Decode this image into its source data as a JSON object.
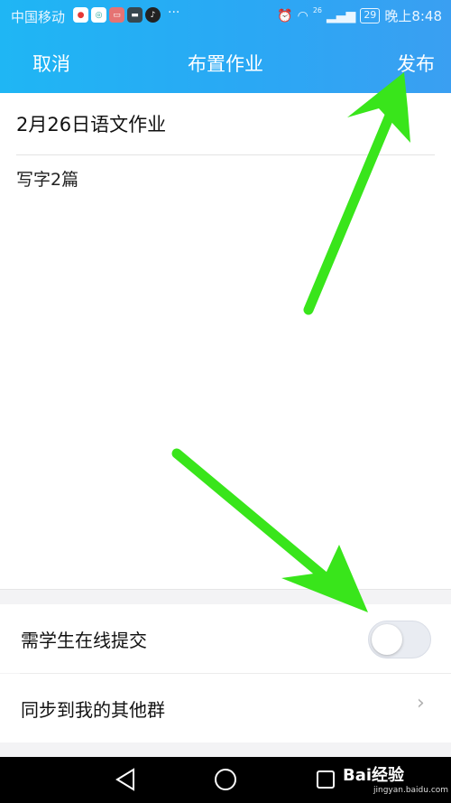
{
  "status_bar": {
    "carrier": "中国移动",
    "dots": "···",
    "network": "26",
    "battery": "29",
    "time": "晚上8:48"
  },
  "nav": {
    "cancel": "取消",
    "title": "布置作业",
    "publish": "发布"
  },
  "homework": {
    "title": "2月26日语文作业",
    "content": "写字2篇"
  },
  "settings": {
    "online_submit_label": "需学生在线提交",
    "online_submit_enabled": false,
    "sync_label": "同步到我的其他群"
  },
  "watermark": {
    "text": "Bai经验",
    "sub": "jingyan.baidu.com"
  },
  "colors": {
    "header": "#2aa8f4",
    "arrow": "#39e51b"
  }
}
